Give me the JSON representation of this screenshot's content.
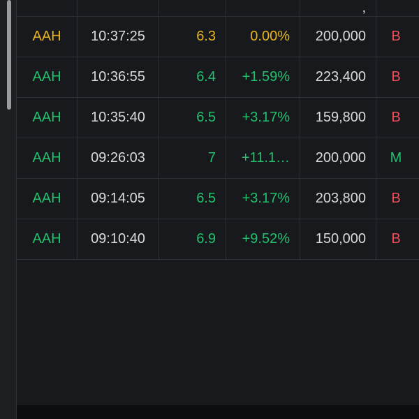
{
  "colors": {
    "reference": "#e6b422",
    "up": "#23c06e",
    "sell": "#ee4e5b",
    "text": "#d9dadc",
    "background": "#16181c"
  },
  "header_partial": {
    "last_vol_fragment": ","
  },
  "trades": [
    {
      "symbol": "AAH",
      "time": "10:37:25",
      "price": "6.3",
      "change": "0.00%",
      "volume": "200,000",
      "side": "B",
      "tone": "reference",
      "side_tone": "sell"
    },
    {
      "symbol": "AAH",
      "time": "10:36:55",
      "price": "6.4",
      "change": "+1.59%",
      "volume": "223,400",
      "side": "B",
      "tone": "up",
      "side_tone": "sell"
    },
    {
      "symbol": "AAH",
      "time": "10:35:40",
      "price": "6.5",
      "change": "+3.17%",
      "volume": "159,800",
      "side": "B",
      "tone": "up",
      "side_tone": "sell"
    },
    {
      "symbol": "AAH",
      "time": "09:26:03",
      "price": "7",
      "change": "+11.1…",
      "volume": "200,000",
      "side": "M",
      "tone": "up",
      "side_tone": "up"
    },
    {
      "symbol": "AAH",
      "time": "09:14:05",
      "price": "6.5",
      "change": "+3.17%",
      "volume": "203,800",
      "side": "B",
      "tone": "up",
      "side_tone": "sell"
    },
    {
      "symbol": "AAH",
      "time": "09:10:40",
      "price": "6.9",
      "change": "+9.52%",
      "volume": "150,000",
      "side": "B",
      "tone": "up",
      "side_tone": "sell"
    }
  ]
}
